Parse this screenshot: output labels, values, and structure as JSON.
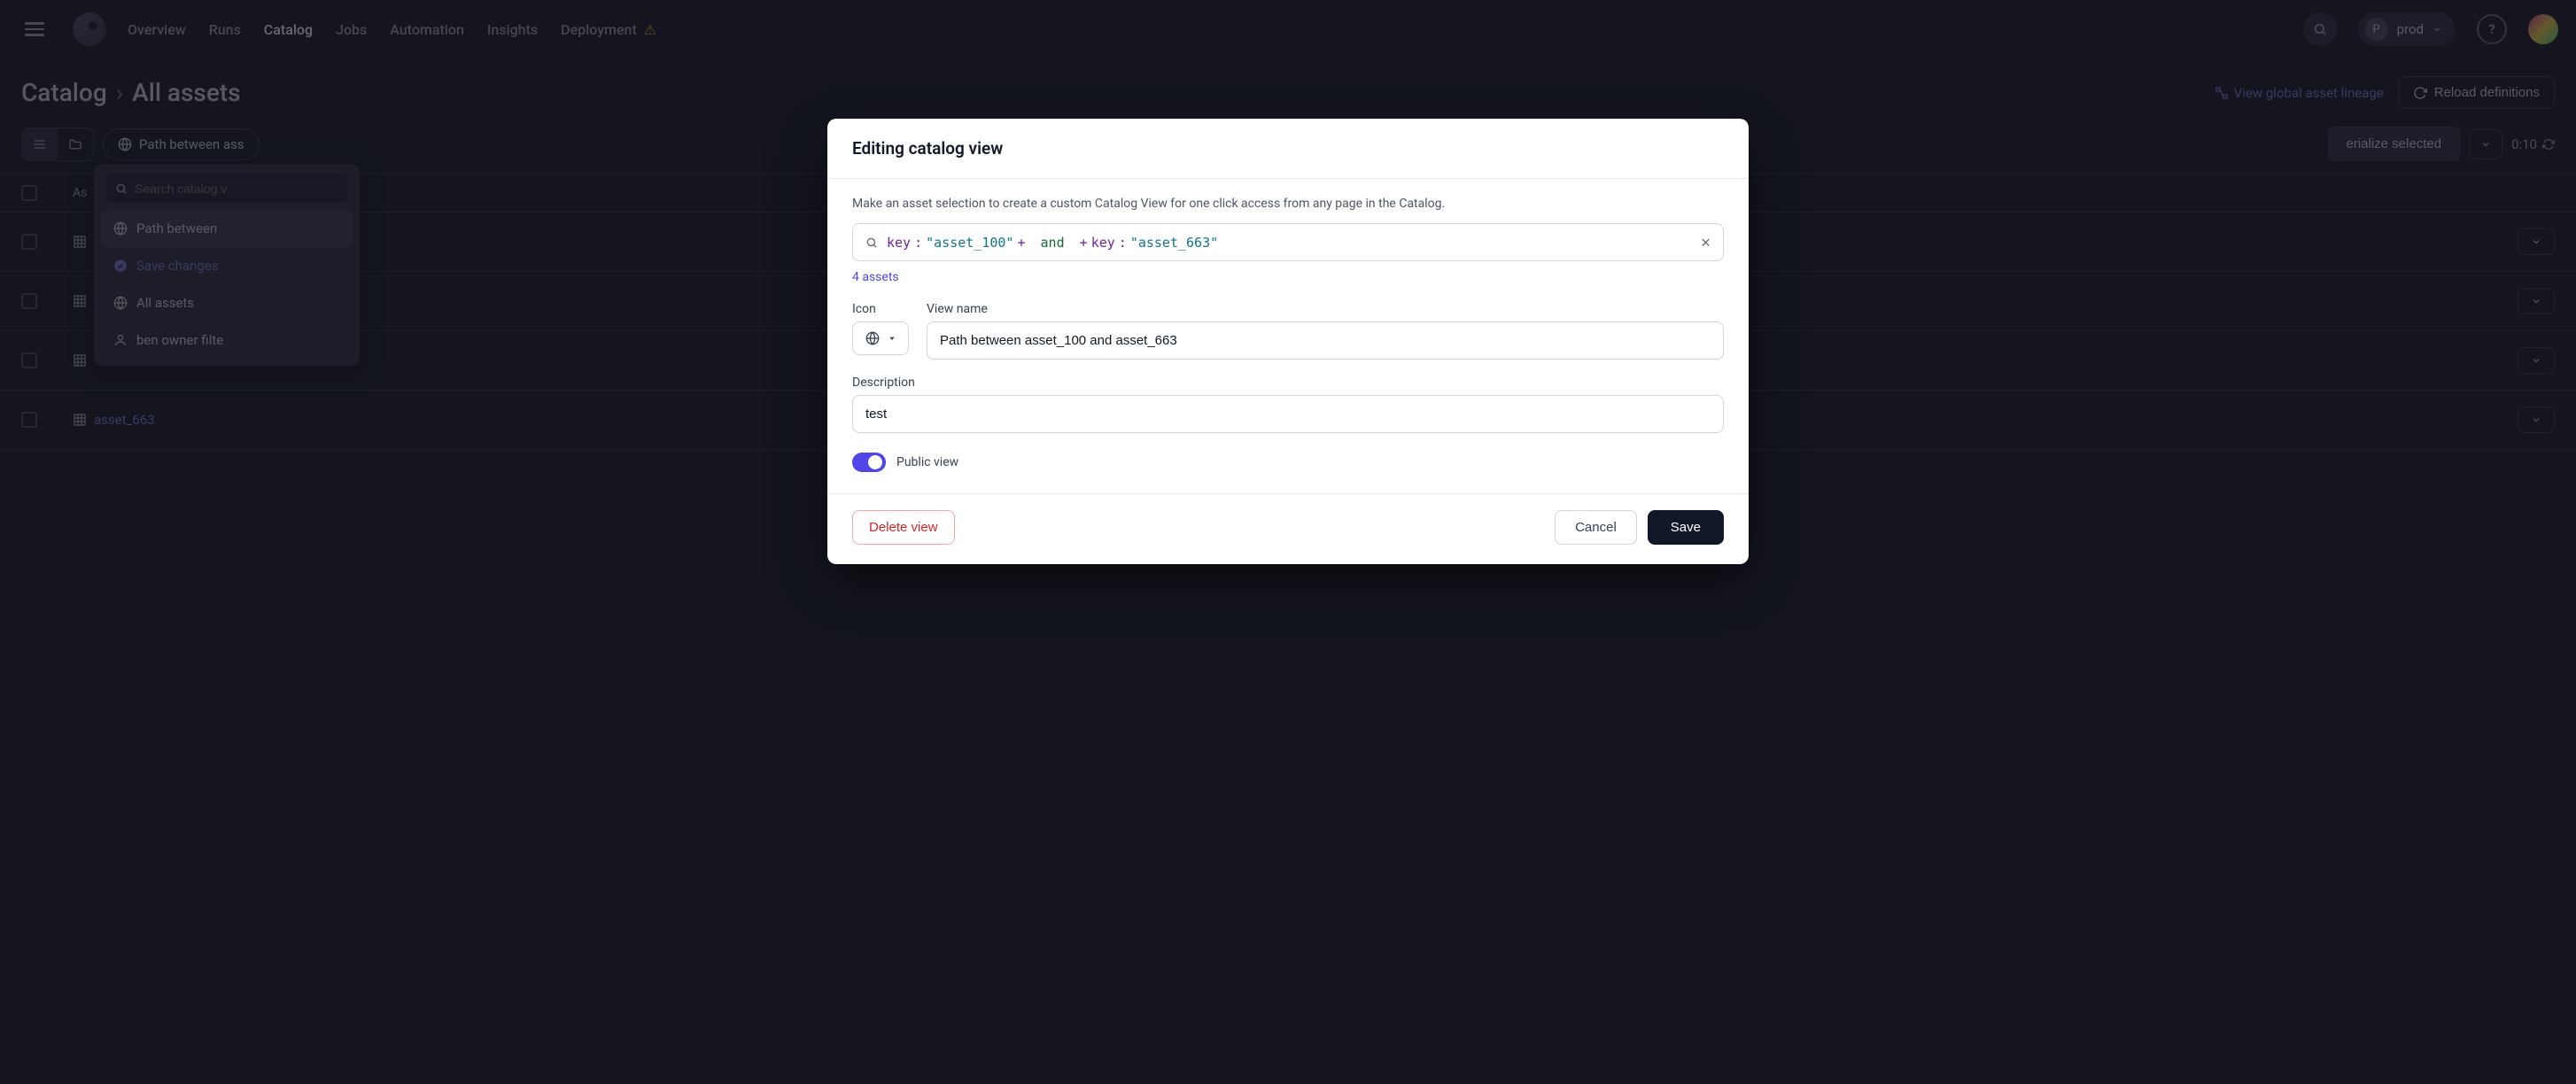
{
  "nav": {
    "items": [
      "Overview",
      "Runs",
      "Catalog",
      "Jobs",
      "Automation",
      "Insights",
      "Deployment"
    ],
    "active": "Catalog",
    "deployment_warning": "⚠"
  },
  "topbar": {
    "env_initial": "P",
    "env_label": "prod",
    "help_label": "?"
  },
  "page": {
    "title_main": "Catalog",
    "title_sub": "All assets",
    "lineage_link": "View global asset lineage",
    "reload_label": "Reload definitions"
  },
  "toolbar": {
    "filter_label": "Path between ass",
    "materialize_label": "erialize selected",
    "time": "0:10"
  },
  "popover": {
    "search_placeholder": "Search catalog v",
    "items": [
      {
        "label": "Path between ",
        "icon": "globe",
        "selected": true
      },
      {
        "label": "Save changes",
        "icon": "check",
        "save": true
      },
      {
        "label": "All assets",
        "icon": "globe"
      },
      {
        "label": "ben owner filte",
        "icon": "person"
      }
    ]
  },
  "table": {
    "header": "As",
    "rows": [
      {
        "asset": "asset_663"
      }
    ],
    "blank_rows": 3
  },
  "modal": {
    "title": "Editing catalog view",
    "description": "Make an asset selection to create a custom Catalog View for one click access from any page in the Catalog.",
    "query": {
      "key1_label": "key",
      "colon": ":",
      "val1": "\"asset_100\"",
      "plus": "+",
      "and": "and",
      "key2_label": "key",
      "val2": "\"asset_663\""
    },
    "asset_count": "4 assets",
    "icon_label": "Icon",
    "view_name_label": "View name",
    "view_name_value": "Path between asset_100 and asset_663",
    "description_label": "Description",
    "description_value": "test",
    "public_label": "Public view",
    "delete_label": "Delete view",
    "cancel_label": "Cancel",
    "save_label": "Save"
  }
}
